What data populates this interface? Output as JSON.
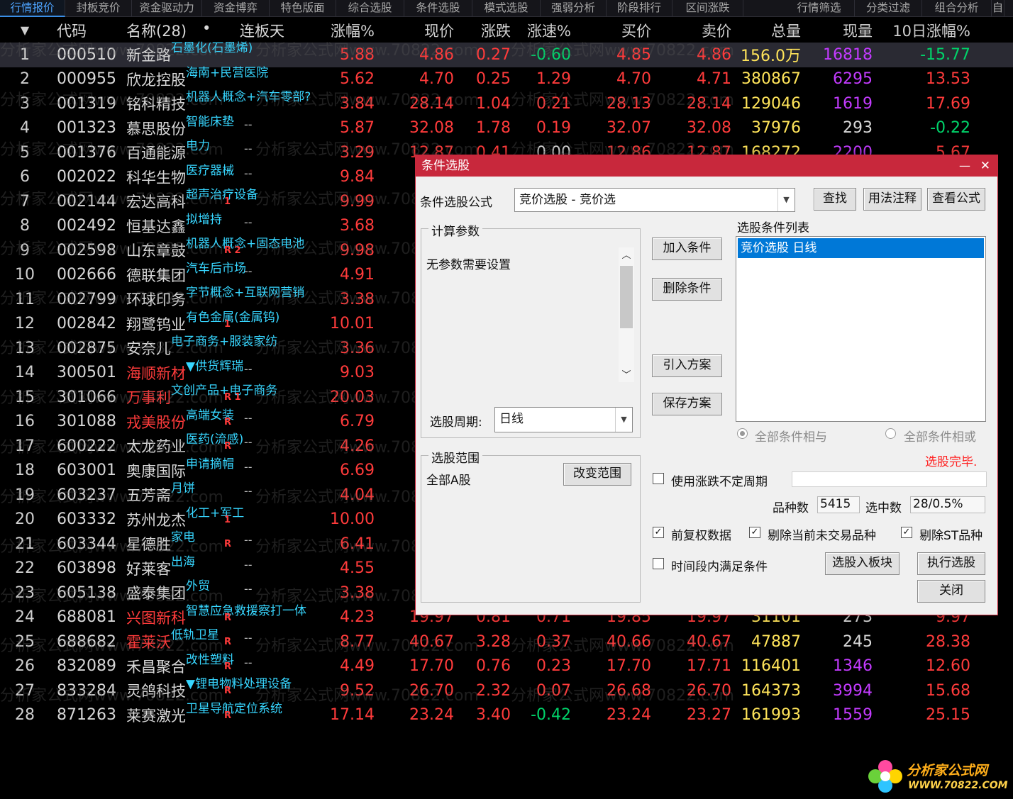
{
  "tabs": [
    "行情报价",
    "封板竞价",
    "资金驱动力",
    "资金博弈",
    "特色版面",
    "综合选股",
    "条件选股",
    "模式选股",
    "强弱分析",
    "阶段排行",
    "区间涨跌",
    "行情筛选",
    "分类过滤",
    "组合分析",
    "自"
  ],
  "headers": {
    "sort_icon": "▼",
    "code": "代码",
    "name": "名称(28)",
    "dot": "•",
    "limit_days": "连板天",
    "change_pct": "涨幅%",
    "price": "现价",
    "change": "涨跌",
    "speed": "涨速%",
    "bid": "买价",
    "ask": "卖价",
    "volume": "总量",
    "current_vol": "现量",
    "ten_day": "10日涨幅%"
  },
  "rows": [
    {
      "i": "1",
      "code": "000510",
      "name": "新金路",
      "tag": "石墨化(石墨烯)",
      "mark": "",
      "days": "",
      "chg": "5.88",
      "price": "4.86",
      "diff": "0.27",
      "spd": "-0.60",
      "bid": "4.85",
      "ask": "4.86",
      "vol": "156.0万",
      "cur": "16818",
      "d10": "-15.77",
      "name_red": false,
      "cur_color": "magenta",
      "d10_color": "green",
      "spd_color": "green",
      "selected": true
    },
    {
      "i": "2",
      "code": "000955",
      "name": "欣龙控股",
      "tag": "海南+民营医院",
      "mark": "",
      "days": "",
      "chg": "5.62",
      "price": "4.70",
      "diff": "0.25",
      "spd": "1.29",
      "bid": "4.70",
      "ask": "4.71",
      "vol": "380867",
      "cur": "6295",
      "d10": "13.53",
      "name_red": false,
      "cur_color": "magenta",
      "d10_color": "red",
      "spd_color": "red"
    },
    {
      "i": "3",
      "code": "001319",
      "name": "铭科精技",
      "tag": "机器人概念+汽车零部?",
      "mark": "",
      "days": "",
      "chg": "3.84",
      "price": "28.14",
      "diff": "1.04",
      "spd": "0.21",
      "bid": "28.13",
      "ask": "28.14",
      "vol": "129046",
      "cur": "1619",
      "d10": "17.69",
      "name_red": false,
      "cur_color": "magenta",
      "d10_color": "red",
      "spd_color": "red"
    },
    {
      "i": "4",
      "code": "001323",
      "name": "慕思股份",
      "tag": "智能床垫",
      "mark": "",
      "days": "--",
      "chg": "5.87",
      "price": "32.08",
      "diff": "1.78",
      "spd": "0.19",
      "bid": "32.07",
      "ask": "32.08",
      "vol": "37976",
      "cur": "293",
      "d10": "-0.22",
      "name_red": false,
      "cur_color": "white",
      "d10_color": "green",
      "spd_color": "red"
    },
    {
      "i": "5",
      "code": "001376",
      "name": "百通能源",
      "tag": "电力",
      "mark": "",
      "days": "--",
      "chg": "3.29",
      "price": "12.87",
      "diff": "0.41",
      "spd": "0.00",
      "bid": "12.86",
      "ask": "12.87",
      "vol": "168272",
      "cur": "2200",
      "d10": "5.67",
      "name_red": false,
      "cur_color": "magenta",
      "d10_color": "red",
      "spd_color": "white"
    },
    {
      "i": "6",
      "code": "002022",
      "name": "科华生物",
      "tag": "医疗器械",
      "mark": "",
      "days": "--",
      "chg": "9.84",
      "price": "",
      "diff": "",
      "spd": "",
      "bid": "",
      "ask": "",
      "vol": "",
      "cur": "",
      "d10": "",
      "name_red": false,
      "cur_color": "white",
      "d10_color": "red",
      "spd_color": "red"
    },
    {
      "i": "7",
      "code": "002144",
      "name": "宏达高科",
      "tag": "超声治疗设备",
      "mark": "1",
      "days": "",
      "chg": "9.99",
      "price": "",
      "diff": "",
      "spd": "",
      "bid": "",
      "ask": "",
      "vol": "",
      "cur": "",
      "d10": "",
      "name_red": false,
      "cur_color": "white",
      "d10_color": "red",
      "spd_color": "red"
    },
    {
      "i": "8",
      "code": "002492",
      "name": "恒基达鑫",
      "tag": "拟增持",
      "mark": "",
      "days": "--",
      "chg": "3.68",
      "price": "",
      "diff": "",
      "spd": "",
      "bid": "",
      "ask": "",
      "vol": "",
      "cur": "",
      "d10": "",
      "name_red": false,
      "cur_color": "white",
      "d10_color": "red",
      "spd_color": "red"
    },
    {
      "i": "9",
      "code": "002598",
      "name": "山东章鼓",
      "tag": "机器人概念+固态电池",
      "mark": "R 2",
      "days": "",
      "chg": "9.98",
      "price": "",
      "diff": "",
      "spd": "",
      "bid": "",
      "ask": "",
      "vol": "",
      "cur": "",
      "d10": "",
      "name_red": false,
      "cur_color": "white",
      "d10_color": "red",
      "spd_color": "red"
    },
    {
      "i": "10",
      "code": "002666",
      "name": "德联集团",
      "tag": "汽车后市场",
      "mark": "",
      "days": "--",
      "chg": "4.91",
      "price": "",
      "diff": "",
      "spd": "",
      "bid": "",
      "ask": "",
      "vol": "",
      "cur": "",
      "d10": "",
      "name_red": false,
      "cur_color": "white",
      "d10_color": "red",
      "spd_color": "red"
    },
    {
      "i": "11",
      "code": "002799",
      "name": "环球印务",
      "tag": "字节概念+互联网营销",
      "mark": "",
      "days": "",
      "chg": "3.38",
      "price": "",
      "diff": "",
      "spd": "",
      "bid": "",
      "ask": "",
      "vol": "",
      "cur": "",
      "d10": "",
      "name_red": false,
      "cur_color": "white",
      "d10_color": "red",
      "spd_color": "red"
    },
    {
      "i": "12",
      "code": "002842",
      "name": "翔鹭钨业",
      "tag": "有色金属(金属钨)",
      "mark": "1",
      "days": "",
      "chg": "10.01",
      "price": "",
      "diff": "",
      "spd": "",
      "bid": "",
      "ask": "",
      "vol": "",
      "cur": "",
      "d10": "",
      "name_red": false,
      "cur_color": "white",
      "d10_color": "red",
      "spd_color": "red"
    },
    {
      "i": "13",
      "code": "002875",
      "name": "安奈儿",
      "tag": "电子商务+服装家纺",
      "mark": "",
      "days": "",
      "chg": "3.36",
      "price": "",
      "diff": "",
      "spd": "",
      "bid": "",
      "ask": "",
      "vol": "",
      "cur": "",
      "d10": "",
      "name_red": false,
      "cur_color": "white",
      "d10_color": "red",
      "spd_color": "red"
    },
    {
      "i": "14",
      "code": "300501",
      "name": "海顺新材",
      "tag": "▼供货辉瑞",
      "mark": "",
      "days": "--",
      "chg": "9.03",
      "price": "",
      "diff": "",
      "spd": "",
      "bid": "",
      "ask": "",
      "vol": "",
      "cur": "",
      "d10": "",
      "name_red": true,
      "cur_color": "white",
      "d10_color": "red",
      "spd_color": "red"
    },
    {
      "i": "15",
      "code": "301066",
      "name": "万事利",
      "tag": "文创产品+电子商务",
      "mark": "R 1",
      "days": "",
      "chg": "20.03",
      "price": "",
      "diff": "",
      "spd": "",
      "bid": "",
      "ask": "",
      "vol": "",
      "cur": "",
      "d10": "",
      "name_red": true,
      "cur_color": "white",
      "d10_color": "red",
      "spd_color": "red"
    },
    {
      "i": "16",
      "code": "301088",
      "name": "戎美股份",
      "tag": "高端女装",
      "mark": "R",
      "days": "--",
      "chg": "6.79",
      "price": "",
      "diff": "",
      "spd": "",
      "bid": "",
      "ask": "",
      "vol": "",
      "cur": "",
      "d10": "",
      "name_red": true,
      "cur_color": "white",
      "d10_color": "red",
      "spd_color": "red"
    },
    {
      "i": "17",
      "code": "600222",
      "name": "太龙药业",
      "tag": "医药(流感)",
      "mark": "R",
      "days": "--",
      "chg": "4.26",
      "price": "",
      "diff": "",
      "spd": "",
      "bid": "",
      "ask": "",
      "vol": "",
      "cur": "",
      "d10": "",
      "name_red": false,
      "cur_color": "white",
      "d10_color": "red",
      "spd_color": "red"
    },
    {
      "i": "18",
      "code": "603001",
      "name": "奥康国际",
      "tag": "申请摘帽",
      "mark": "",
      "days": "--",
      "chg": "6.69",
      "price": "",
      "diff": "",
      "spd": "",
      "bid": "",
      "ask": "",
      "vol": "",
      "cur": "",
      "d10": "",
      "name_red": false,
      "cur_color": "white",
      "d10_color": "red",
      "spd_color": "red"
    },
    {
      "i": "19",
      "code": "603237",
      "name": "五芳斋",
      "tag": "月饼",
      "mark": "",
      "days": "--",
      "chg": "4.04",
      "price": "",
      "diff": "",
      "spd": "",
      "bid": "",
      "ask": "",
      "vol": "",
      "cur": "",
      "d10": "",
      "name_red": false,
      "cur_color": "white",
      "d10_color": "red",
      "spd_color": "red"
    },
    {
      "i": "20",
      "code": "603332",
      "name": "苏州龙杰",
      "tag": "化工+军工",
      "mark": "1",
      "days": "",
      "chg": "10.00",
      "price": "",
      "diff": "",
      "spd": "",
      "bid": "",
      "ask": "",
      "vol": "",
      "cur": "",
      "d10": "",
      "name_red": false,
      "cur_color": "white",
      "d10_color": "red",
      "spd_color": "red"
    },
    {
      "i": "21",
      "code": "603344",
      "name": "星德胜",
      "tag": "家电",
      "mark": "R",
      "days": "--",
      "chg": "6.41",
      "price": "",
      "diff": "",
      "spd": "",
      "bid": "",
      "ask": "",
      "vol": "",
      "cur": "",
      "d10": "",
      "name_red": false,
      "cur_color": "white",
      "d10_color": "red",
      "spd_color": "red"
    },
    {
      "i": "22",
      "code": "603898",
      "name": "好莱客",
      "tag": "出海",
      "mark": "",
      "days": "--",
      "chg": "4.55",
      "price": "",
      "diff": "",
      "spd": "",
      "bid": "",
      "ask": "",
      "vol": "",
      "cur": "",
      "d10": "",
      "name_red": false,
      "cur_color": "white",
      "d10_color": "red",
      "spd_color": "red"
    },
    {
      "i": "23",
      "code": "605138",
      "name": "盛泰集团",
      "tag": "外贸",
      "mark": "",
      "days": "--",
      "chg": "3.38",
      "price": "",
      "diff": "",
      "spd": "",
      "bid": "",
      "ask": "",
      "vol": "",
      "cur": "",
      "d10": "",
      "name_red": false,
      "cur_color": "white",
      "d10_color": "red",
      "spd_color": "red"
    },
    {
      "i": "24",
      "code": "688081",
      "name": "兴图新科",
      "tag": "智慧应急救援察打一体",
      "mark": "R",
      "days": "",
      "chg": "4.23",
      "price": "19.97",
      "diff": "0.81",
      "spd": "0.71",
      "bid": "19.85",
      "ask": "19.97",
      "vol": "31101",
      "cur": "273",
      "d10": "9.97",
      "name_red": true,
      "cur_color": "white",
      "d10_color": "red",
      "spd_color": "red"
    },
    {
      "i": "25",
      "code": "688682",
      "name": "霍莱沃",
      "tag": "低轨卫星",
      "mark": "R",
      "days": "--",
      "chg": "8.77",
      "price": "40.67",
      "diff": "3.28",
      "spd": "0.37",
      "bid": "40.66",
      "ask": "40.67",
      "vol": "47887",
      "cur": "245",
      "d10": "28.38",
      "name_red": true,
      "cur_color": "white",
      "d10_color": "red",
      "spd_color": "red"
    },
    {
      "i": "26",
      "code": "832089",
      "name": "禾昌聚合",
      "tag": "改性塑料",
      "mark": "R",
      "days": "--",
      "chg": "4.49",
      "price": "17.70",
      "diff": "0.76",
      "spd": "0.23",
      "bid": "17.70",
      "ask": "17.71",
      "vol": "116401",
      "cur": "1346",
      "d10": "12.60",
      "name_red": false,
      "cur_color": "magenta",
      "d10_color": "red",
      "spd_color": "red"
    },
    {
      "i": "27",
      "code": "833284",
      "name": "灵鸽科技",
      "tag": "▼锂电物料处理设备",
      "mark": "R",
      "days": "",
      "chg": "9.52",
      "price": "26.70",
      "diff": "2.32",
      "spd": "0.07",
      "bid": "26.68",
      "ask": "26.70",
      "vol": "164373",
      "cur": "3994",
      "d10": "15.68",
      "name_red": false,
      "cur_color": "magenta",
      "d10_color": "red",
      "spd_color": "red"
    },
    {
      "i": "28",
      "code": "871263",
      "name": "莱赛激光",
      "tag": "卫星导航定位系统",
      "mark": "R",
      "days": "",
      "chg": "17.14",
      "price": "23.24",
      "diff": "3.40",
      "spd": "-0.42",
      "bid": "23.24",
      "ask": "23.27",
      "vol": "161993",
      "cur": "1559",
      "d10": "25.15",
      "name_red": false,
      "cur_color": "magenta",
      "d10_color": "red",
      "spd_color": "green"
    }
  ],
  "watermark": "分析家公式网www.70822.com",
  "dialog": {
    "title": "条件选股",
    "minimize": "—",
    "close": "✕",
    "formula_label": "条件选股公式",
    "formula_value": "竞价选股  -  竞价选",
    "find_btn": "查找",
    "usage_btn": "用法注释",
    "view_btn": "查看公式",
    "params_group": "计算参数",
    "params_text": "无参数需要设置",
    "period_label": "选股周期:",
    "period_value": "日线",
    "add_btn": "加入条件",
    "del_btn": "删除条件",
    "import_btn": "引入方案",
    "save_btn": "保存方案",
    "cond_list_label": "选股条件列表",
    "cond_items": [
      "竞价选股  日线"
    ],
    "radio_and": "全部条件相与",
    "radio_or": "全部条件相或",
    "status": "选股完毕.",
    "range_group": "选股范围",
    "range_value": "全部A股",
    "change_range_btn": "改变范围",
    "uncertain_period": "使用涨跌不定周期",
    "count_label": "品种数",
    "count_value": "5415",
    "selected_label": "选中数",
    "selected_value": "28/0.5%",
    "chk_fq": "前复权数据",
    "chk_fq_checked": true,
    "chk_untraded": "剔除当前未交易品种",
    "chk_untraded_checked": true,
    "chk_st": "剔除ST品种",
    "chk_st_checked": true,
    "chk_period": "时间段内满足条件",
    "chk_period_checked": false,
    "to_block_btn": "选股入板块",
    "run_btn": "执行选股",
    "close_btn": "关闭"
  },
  "logo": {
    "title": "分析家公式网",
    "url": "WWW.70822.COM"
  },
  "colors": {
    "up": "#ff3b3b",
    "down": "#00d36a",
    "tag": "#37d6ff",
    "volume": "#ffe45a",
    "current_vol": "#c33bff",
    "dialog_title": "#c8283c"
  }
}
